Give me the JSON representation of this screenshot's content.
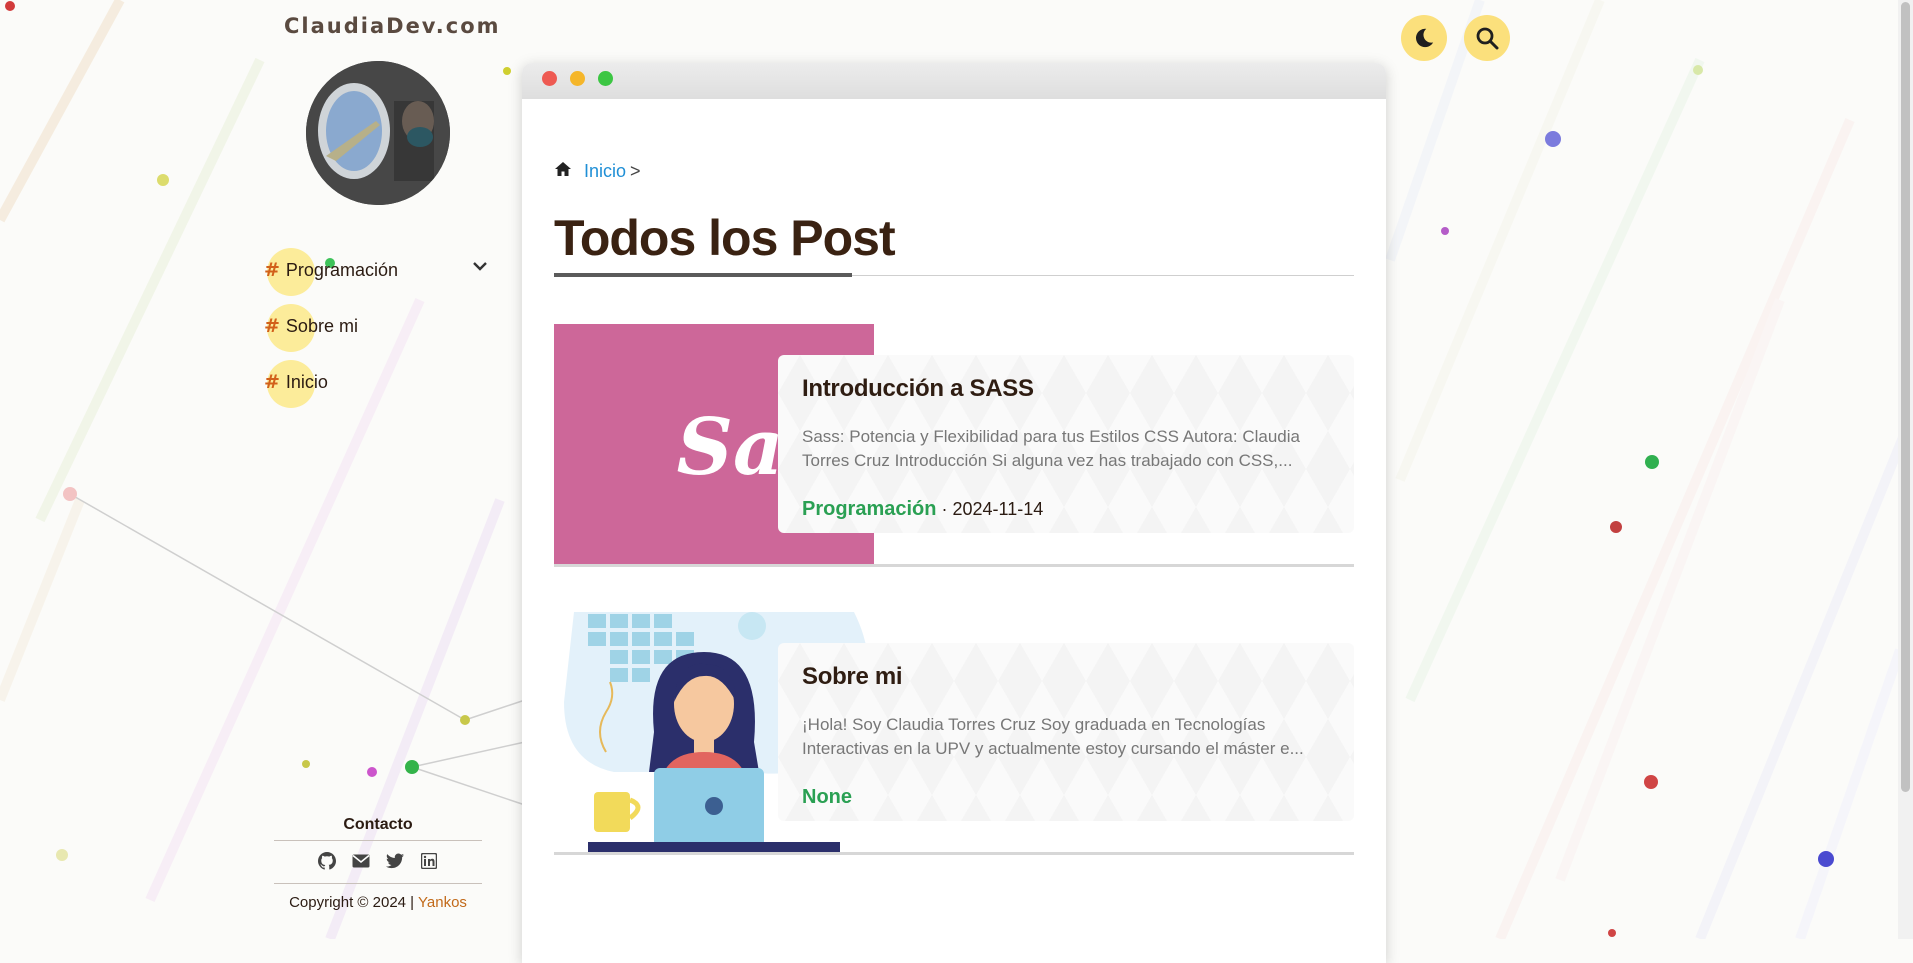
{
  "site": {
    "title": "ClaudiaDev.com"
  },
  "nav": {
    "items": [
      {
        "hash": "#",
        "label": "Programación",
        "has_submenu": true
      },
      {
        "hash": "#",
        "label": "Sobre mi",
        "has_submenu": false
      },
      {
        "hash": "#",
        "label": "Inicio",
        "has_submenu": false
      }
    ]
  },
  "contact": {
    "title": "Contacto",
    "icons": [
      "github-icon",
      "email-icon",
      "twitter-icon",
      "linkedin-icon"
    ],
    "copyright_text": "Copyright © 2024 |",
    "copyright_link": "Yankos"
  },
  "header_buttons": {
    "theme": "moon-icon",
    "search": "search-icon"
  },
  "breadcrumb": {
    "link": "Inicio",
    "separator": ">"
  },
  "page": {
    "title": "Todos los Post"
  },
  "posts": [
    {
      "title": "Introducción a SASS",
      "excerpt": "Sass: Potencia y Flexibilidad para tus Estilos CSS Autora: Claudia Torres Cruz Introducción Si alguna vez has trabajado con CSS,...",
      "category": "Programación",
      "date": "· 2024-11-14",
      "thumb": "sass-logo",
      "thumb_text": "Sass"
    },
    {
      "title": "Sobre mi",
      "excerpt": "¡Hola! Soy Claudia Torres Cruz Soy graduada en Tecnologías Interactivas en la UPV y actualmente estoy cursando el máster e...",
      "category": "None",
      "date": "",
      "thumb": "woman-laptop-illustration"
    }
  ],
  "colors": {
    "accent_yellow": "#fbe98a",
    "link_blue": "#1f8fd6",
    "category_green": "#2aa053",
    "sass_pink": "#cd6799"
  }
}
